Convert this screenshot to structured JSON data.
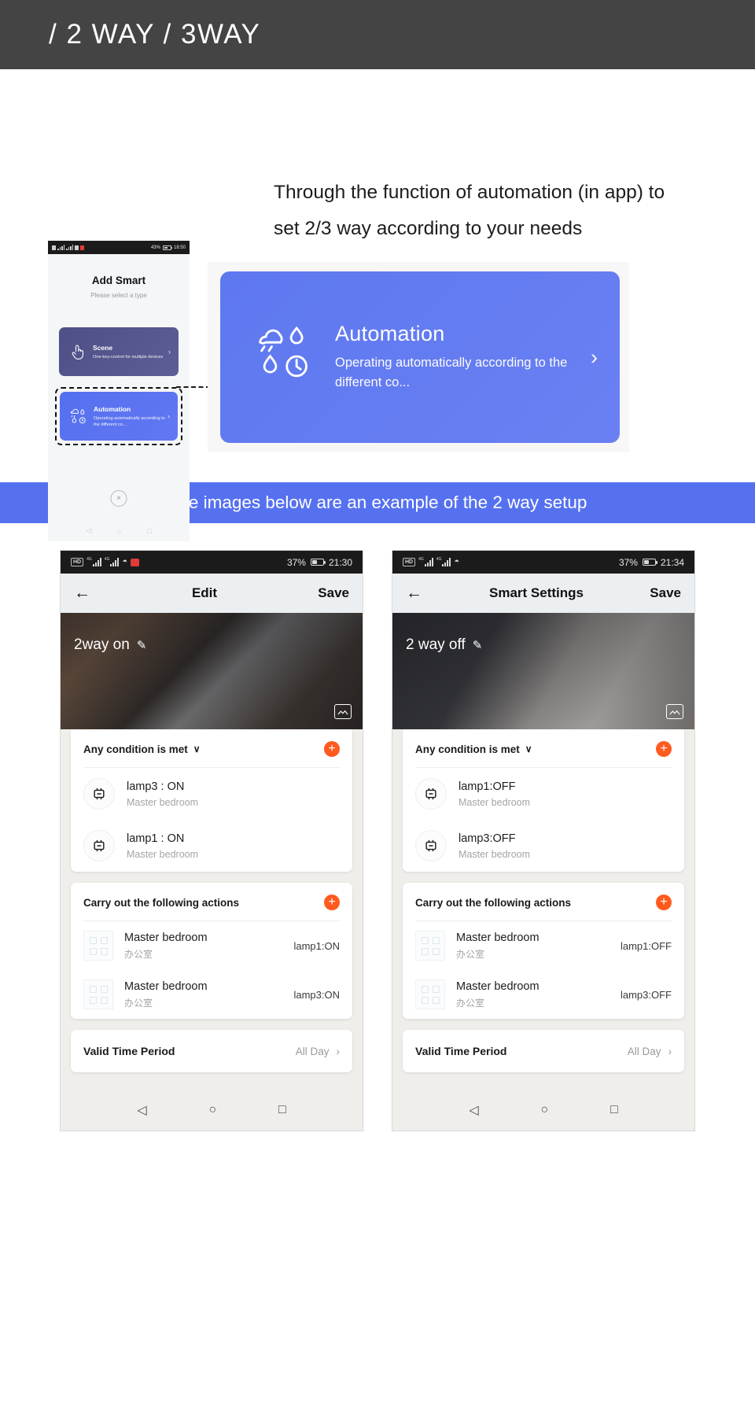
{
  "header": {
    "title": "/ 2 WAY / 3WAY"
  },
  "intro": {
    "paragraph": "Through the function of automation (in app) to set 2/3 way according to your needs"
  },
  "mini_phone": {
    "status": {
      "battery": "43%",
      "time": "18:50"
    },
    "title": "Add Smart",
    "subtitle": "Please select a type",
    "cards": [
      {
        "name": "Scene",
        "desc": "One-key-control for multiple devices",
        "icon": "hand-tap-icon",
        "chevron": "›"
      },
      {
        "name": "Automation",
        "desc": "Operating automatically according to the different co...",
        "icon": "weather-automation-icon",
        "chevron": "›"
      }
    ],
    "close_icon": "×",
    "nav": {
      "back": "◁",
      "home": "○",
      "recents": "□"
    }
  },
  "callout": {
    "title": "Automation",
    "desc": "Operating automatically according to the different co...",
    "chevron": "›",
    "icon": "weather-automation-icon",
    "color": "#5e78f0"
  },
  "banner": {
    "text": "The images below are an example of the 2 way setup",
    "color": "#5671ef"
  },
  "phones": [
    {
      "status": {
        "hd": "HD",
        "net1": "4G",
        "net2": "4G",
        "battery": "37%",
        "time": "21:30"
      },
      "appbar": {
        "back": "←",
        "title": "Edit",
        "save": "Save"
      },
      "hero": {
        "label": "2way on",
        "edit_icon": "✎",
        "image_icon": "image-swap-icon"
      },
      "condition_card": {
        "heading": "Any condition is met",
        "caret": "∨",
        "add": "+",
        "rows": [
          {
            "title": "lamp3 : ON",
            "subtitle": "Master bedroom",
            "icon": "smart-plug-icon"
          },
          {
            "title": "lamp1 : ON",
            "subtitle": "Master bedroom",
            "icon": "smart-plug-icon"
          }
        ]
      },
      "action_card": {
        "heading": "Carry out the following actions",
        "add": "+",
        "rows": [
          {
            "title": "Master bedroom",
            "subtitle": "办公室",
            "value": "lamp1:ON",
            "icon": "switch-panel-icon"
          },
          {
            "title": "Master bedroom",
            "subtitle": "办公室",
            "value": "lamp3:ON",
            "icon": "switch-panel-icon"
          }
        ]
      },
      "valid": {
        "label": "Valid Time Period",
        "value": "All Day",
        "chevron": "›"
      },
      "nav": {
        "back": "◁",
        "home": "○",
        "recents": "□"
      }
    },
    {
      "status": {
        "hd": "HD",
        "net1": "4G",
        "net2": "4G",
        "battery": "37%",
        "time": "21:34"
      },
      "appbar": {
        "back": "←",
        "title": "Smart Settings",
        "save": "Save"
      },
      "hero": {
        "label": "2 way off",
        "edit_icon": "✎",
        "image_icon": "image-swap-icon"
      },
      "condition_card": {
        "heading": "Any condition is met",
        "caret": "∨",
        "add": "+",
        "rows": [
          {
            "title": "lamp1:OFF",
            "subtitle": "Master bedroom",
            "icon": "smart-plug-icon"
          },
          {
            "title": "lamp3:OFF",
            "subtitle": "Master bedroom",
            "icon": "smart-plug-icon"
          }
        ]
      },
      "action_card": {
        "heading": "Carry out the following actions",
        "add": "+",
        "rows": [
          {
            "title": "Master bedroom",
            "subtitle": "办公室",
            "value": "lamp1:OFF",
            "icon": "switch-panel-icon"
          },
          {
            "title": "Master bedroom",
            "subtitle": "办公室",
            "value": "lamp3:OFF",
            "icon": "switch-panel-icon"
          }
        ]
      },
      "valid": {
        "label": "Valid Time Period",
        "value": "All Day",
        "chevron": "›"
      },
      "nav": {
        "back": "◁",
        "home": "○",
        "recents": "□"
      }
    }
  ]
}
